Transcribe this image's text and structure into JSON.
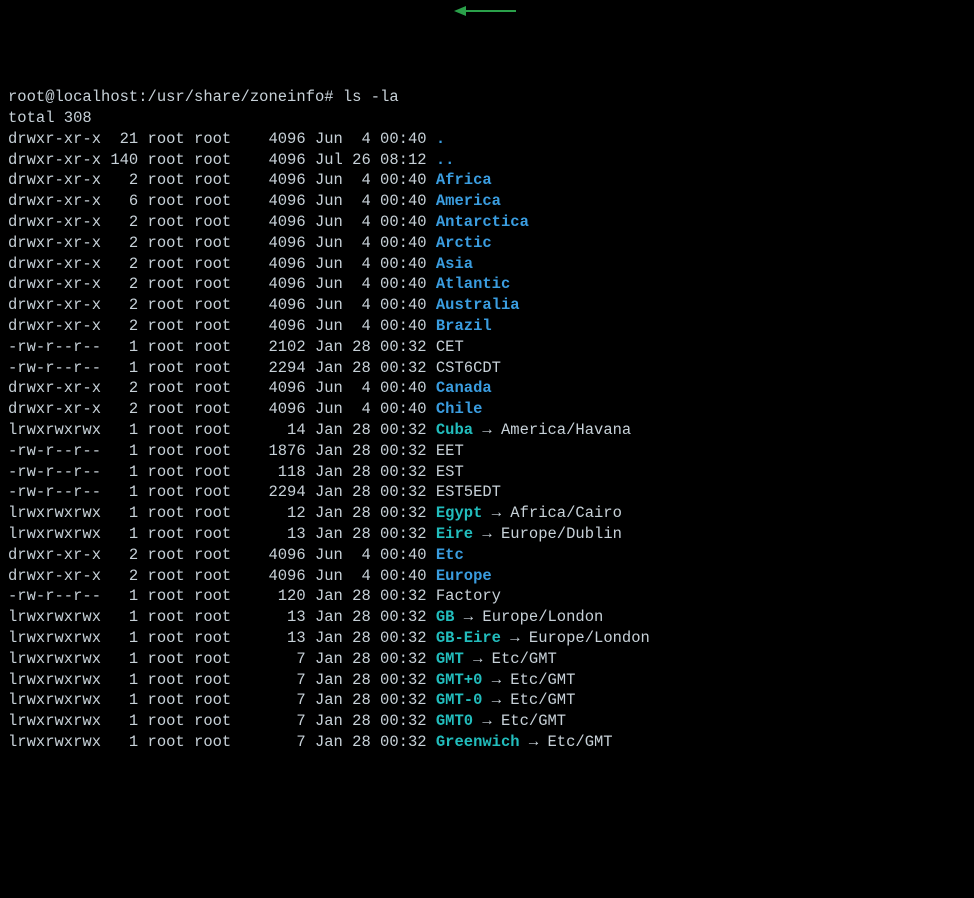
{
  "prompt": {
    "text": "root@localhost:/usr/share/zoneinfo#",
    "command": "ls -la"
  },
  "total": "total 308",
  "entries": [
    {
      "perm": "drwxr-xr-x",
      "links": "21",
      "owner": "root",
      "group": "root",
      "size": "4096",
      "date": "Jun  4 00:40",
      "name": ".",
      "type": "dir"
    },
    {
      "perm": "drwxr-xr-x",
      "links": "140",
      "owner": "root",
      "group": "root",
      "size": "4096",
      "date": "Jul 26 08:12",
      "name": "..",
      "type": "dir"
    },
    {
      "perm": "drwxr-xr-x",
      "links": "2",
      "owner": "root",
      "group": "root",
      "size": "4096",
      "date": "Jun  4 00:40",
      "name": "Africa",
      "type": "dir"
    },
    {
      "perm": "drwxr-xr-x",
      "links": "6",
      "owner": "root",
      "group": "root",
      "size": "4096",
      "date": "Jun  4 00:40",
      "name": "America",
      "type": "dir"
    },
    {
      "perm": "drwxr-xr-x",
      "links": "2",
      "owner": "root",
      "group": "root",
      "size": "4096",
      "date": "Jun  4 00:40",
      "name": "Antarctica",
      "type": "dir"
    },
    {
      "perm": "drwxr-xr-x",
      "links": "2",
      "owner": "root",
      "group": "root",
      "size": "4096",
      "date": "Jun  4 00:40",
      "name": "Arctic",
      "type": "dir"
    },
    {
      "perm": "drwxr-xr-x",
      "links": "2",
      "owner": "root",
      "group": "root",
      "size": "4096",
      "date": "Jun  4 00:40",
      "name": "Asia",
      "type": "dir"
    },
    {
      "perm": "drwxr-xr-x",
      "links": "2",
      "owner": "root",
      "group": "root",
      "size": "4096",
      "date": "Jun  4 00:40",
      "name": "Atlantic",
      "type": "dir"
    },
    {
      "perm": "drwxr-xr-x",
      "links": "2",
      "owner": "root",
      "group": "root",
      "size": "4096",
      "date": "Jun  4 00:40",
      "name": "Australia",
      "type": "dir"
    },
    {
      "perm": "drwxr-xr-x",
      "links": "2",
      "owner": "root",
      "group": "root",
      "size": "4096",
      "date": "Jun  4 00:40",
      "name": "Brazil",
      "type": "dir"
    },
    {
      "perm": "-rw-r--r--",
      "links": "1",
      "owner": "root",
      "group": "root",
      "size": "2102",
      "date": "Jan 28 00:32",
      "name": "CET",
      "type": "file"
    },
    {
      "perm": "-rw-r--r--",
      "links": "1",
      "owner": "root",
      "group": "root",
      "size": "2294",
      "date": "Jan 28 00:32",
      "name": "CST6CDT",
      "type": "file"
    },
    {
      "perm": "drwxr-xr-x",
      "links": "2",
      "owner": "root",
      "group": "root",
      "size": "4096",
      "date": "Jun  4 00:40",
      "name": "Canada",
      "type": "dir"
    },
    {
      "perm": "drwxr-xr-x",
      "links": "2",
      "owner": "root",
      "group": "root",
      "size": "4096",
      "date": "Jun  4 00:40",
      "name": "Chile",
      "type": "dir"
    },
    {
      "perm": "lrwxrwxrwx",
      "links": "1",
      "owner": "root",
      "group": "root",
      "size": "14",
      "date": "Jan 28 00:32",
      "name": "Cuba",
      "type": "link",
      "target": "America/Havana"
    },
    {
      "perm": "-rw-r--r--",
      "links": "1",
      "owner": "root",
      "group": "root",
      "size": "1876",
      "date": "Jan 28 00:32",
      "name": "EET",
      "type": "file"
    },
    {
      "perm": "-rw-r--r--",
      "links": "1",
      "owner": "root",
      "group": "root",
      "size": "118",
      "date": "Jan 28 00:32",
      "name": "EST",
      "type": "file"
    },
    {
      "perm": "-rw-r--r--",
      "links": "1",
      "owner": "root",
      "group": "root",
      "size": "2294",
      "date": "Jan 28 00:32",
      "name": "EST5EDT",
      "type": "file"
    },
    {
      "perm": "lrwxrwxrwx",
      "links": "1",
      "owner": "root",
      "group": "root",
      "size": "12",
      "date": "Jan 28 00:32",
      "name": "Egypt",
      "type": "link",
      "target": "Africa/Cairo"
    },
    {
      "perm": "lrwxrwxrwx",
      "links": "1",
      "owner": "root",
      "group": "root",
      "size": "13",
      "date": "Jan 28 00:32",
      "name": "Eire",
      "type": "link",
      "target": "Europe/Dublin"
    },
    {
      "perm": "drwxr-xr-x",
      "links": "2",
      "owner": "root",
      "group": "root",
      "size": "4096",
      "date": "Jun  4 00:40",
      "name": "Etc",
      "type": "dir"
    },
    {
      "perm": "drwxr-xr-x",
      "links": "2",
      "owner": "root",
      "group": "root",
      "size": "4096",
      "date": "Jun  4 00:40",
      "name": "Europe",
      "type": "dir"
    },
    {
      "perm": "-rw-r--r--",
      "links": "1",
      "owner": "root",
      "group": "root",
      "size": "120",
      "date": "Jan 28 00:32",
      "name": "Factory",
      "type": "file"
    },
    {
      "perm": "lrwxrwxrwx",
      "links": "1",
      "owner": "root",
      "group": "root",
      "size": "13",
      "date": "Jan 28 00:32",
      "name": "GB",
      "type": "link",
      "target": "Europe/London"
    },
    {
      "perm": "lrwxrwxrwx",
      "links": "1",
      "owner": "root",
      "group": "root",
      "size": "13",
      "date": "Jan 28 00:32",
      "name": "GB-Eire",
      "type": "link",
      "target": "Europe/London"
    },
    {
      "perm": "lrwxrwxrwx",
      "links": "1",
      "owner": "root",
      "group": "root",
      "size": "7",
      "date": "Jan 28 00:32",
      "name": "GMT",
      "type": "link",
      "target": "Etc/GMT"
    },
    {
      "perm": "lrwxrwxrwx",
      "links": "1",
      "owner": "root",
      "group": "root",
      "size": "7",
      "date": "Jan 28 00:32",
      "name": "GMT+0",
      "type": "link",
      "target": "Etc/GMT"
    },
    {
      "perm": "lrwxrwxrwx",
      "links": "1",
      "owner": "root",
      "group": "root",
      "size": "7",
      "date": "Jan 28 00:32",
      "name": "GMT-0",
      "type": "link",
      "target": "Etc/GMT"
    },
    {
      "perm": "lrwxrwxrwx",
      "links": "1",
      "owner": "root",
      "group": "root",
      "size": "7",
      "date": "Jan 28 00:32",
      "name": "GMT0",
      "type": "link",
      "target": "Etc/GMT"
    },
    {
      "perm": "lrwxrwxrwx",
      "links": "1",
      "owner": "root",
      "group": "root",
      "size": "7",
      "date": "Jan 28 00:32",
      "name": "Greenwich",
      "type": "link",
      "target": "Etc/GMT"
    }
  ]
}
